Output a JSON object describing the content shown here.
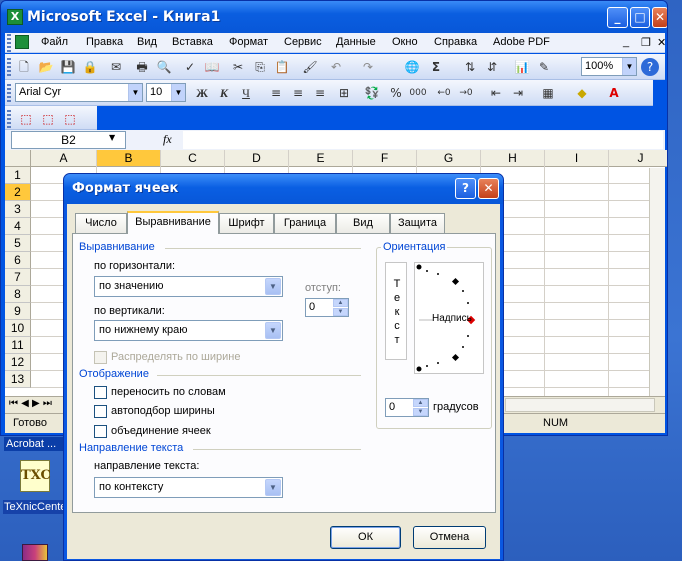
{
  "excel": {
    "title": "Microsoft Excel - Книга1",
    "icon_letter": "X",
    "window_buttons": {
      "minimize": "_",
      "maximize": "□",
      "close": "✕"
    },
    "menu": [
      "Файл",
      "Правка",
      "Вид",
      "Вставка",
      "Формат",
      "Сервис",
      "Данные",
      "Окно",
      "Справка",
      "Adobe PDF"
    ],
    "doc_buttons": {
      "min": "_",
      "restore": "❐",
      "close": "✕"
    },
    "zoom": "100%",
    "font_name": "Arial Cyr",
    "font_size": "10",
    "bold": "Ж",
    "italic": "К",
    "underline": "Ч",
    "percent": "%",
    "thousands": "000",
    "name_box": "B2",
    "fx": "fx",
    "columns": [
      "A",
      "B",
      "C",
      "D",
      "E",
      "F",
      "G",
      "H",
      "I",
      "J"
    ],
    "rows": [
      "1",
      "2",
      "3",
      "4",
      "5",
      "6",
      "7",
      "8",
      "9",
      "10",
      "11",
      "12",
      "13"
    ],
    "status": "Готово",
    "status_num": "NUM"
  },
  "desktop": {
    "task_label": "Acrobat ...",
    "icon_text": "TXC",
    "icon_label": "TeXnicCente"
  },
  "dialog": {
    "title": "Формат ячеек",
    "help": "?",
    "close": "✕",
    "tabs": [
      "Число",
      "Выравнивание",
      "Шрифт",
      "Граница",
      "Вид",
      "Защита"
    ],
    "active_tab": "Выравнивание",
    "alignment_group": "Выравнивание",
    "horizontal_label": "по горизонтали:",
    "horizontal_value": "по значению",
    "indent_label": "отступ:",
    "indent_value": "0",
    "vertical_label": "по вертикали:",
    "vertical_value": "по нижнему краю",
    "distribute_label": "Распределять по ширине",
    "display_group": "Отображение",
    "wrap_label": "переносить по словам",
    "shrink_label": "автоподбор ширины",
    "merge_label": "объединение ячеек",
    "direction_group": "Направление текста",
    "direction_label": "направление текста:",
    "direction_value": "по контексту",
    "orientation_group": "Ориентация",
    "vertical_text": [
      "Т",
      "е",
      "к",
      "с",
      "т"
    ],
    "dial_label": "Надпись",
    "degrees_value": "0",
    "degrees_label": "градусов",
    "ok": "ОК",
    "cancel": "Отмена"
  },
  "colors": {
    "accent": "#0a58e2",
    "dialog_bg": "#ece9d8",
    "group_text": "#0046d5",
    "selected_cell": "#ffc83c"
  }
}
